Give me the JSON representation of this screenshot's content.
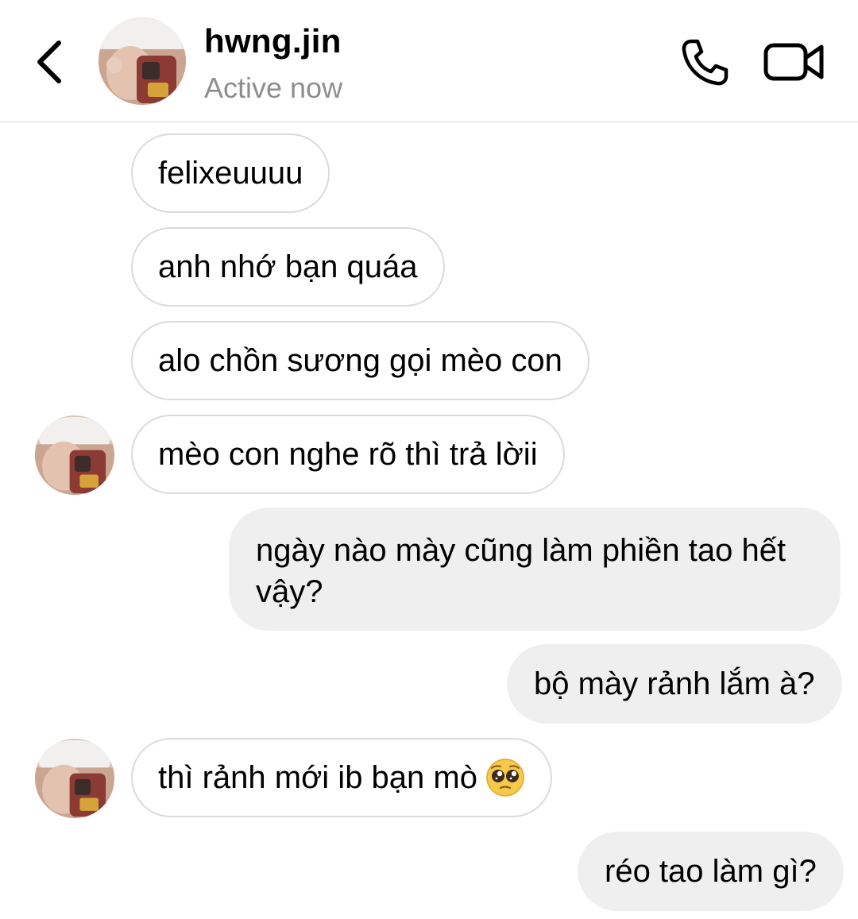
{
  "header": {
    "username": "hwng.jin",
    "status": "Active now"
  },
  "messages": [
    {
      "side": "in",
      "text": "felixeuuuu"
    },
    {
      "side": "in",
      "text": "anh nhớ bạn quáa"
    },
    {
      "side": "in",
      "text": "alo chồn sương gọi mèo con"
    },
    {
      "side": "in",
      "text": "mèo con nghe rõ thì trả lờii"
    },
    {
      "side": "out",
      "text": "ngày nào mày cũng làm phiền tao hết vậy?"
    },
    {
      "side": "out",
      "text": "bộ mày rảnh lắm à?"
    },
    {
      "side": "in",
      "text": "thì rảnh mới ib bạn mò",
      "emoji": "pleading-face"
    },
    {
      "side": "out",
      "text": "réo tao làm gì?"
    }
  ],
  "colors": {
    "incoming_border": "#dbdbdb",
    "outgoing_bg": "#efefef",
    "secondary_text": "#8e8e8e"
  }
}
